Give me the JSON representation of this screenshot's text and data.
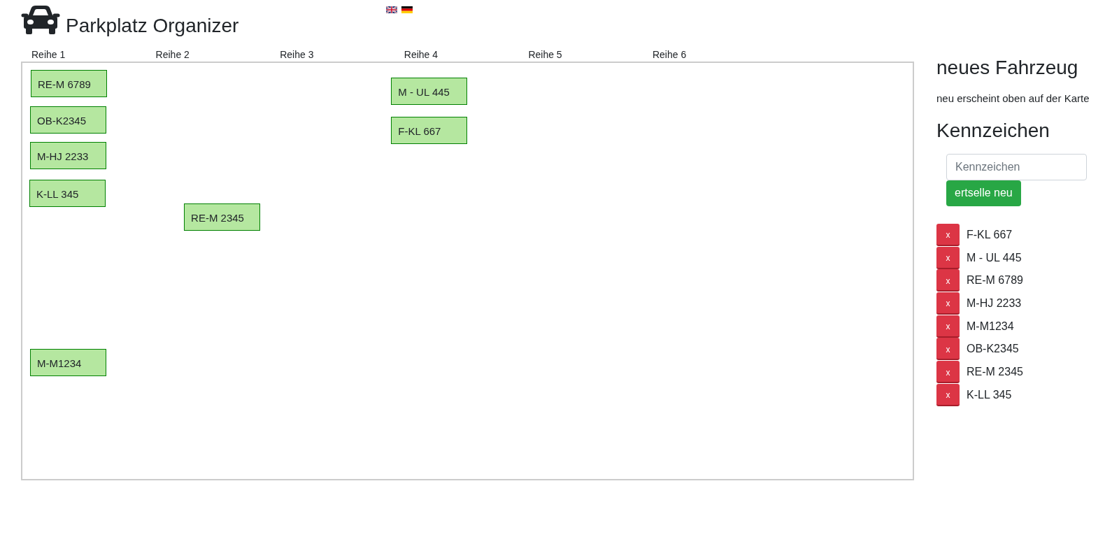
{
  "header": {
    "title": "Parkplatz Organizer"
  },
  "map": {
    "lanes": [
      {
        "label": "Reihe 1",
        "cars": [
          {
            "plate": "RE-M 6789"
          },
          {
            "plate": "OB-K2345"
          },
          {
            "plate": "M-HJ 2233"
          },
          {
            "plate": "K-LL 345"
          },
          {
            "plate": "M-M1234"
          }
        ]
      },
      {
        "label": "Reihe 2",
        "cars": [
          {
            "plate": "RE-M 2345"
          }
        ]
      },
      {
        "label": "Reihe 3"
      },
      {
        "label": "Reihe 4",
        "cars": [
          {
            "plate": "M - UL 445"
          },
          {
            "plate": "F-KL 667"
          }
        ]
      },
      {
        "label": "Reihe 5"
      },
      {
        "label": "Reihe 6"
      }
    ]
  },
  "new_vehicle": {
    "title": "neues Fahrzeug",
    "hint": "neu erscheint oben auf der Karte",
    "plate_heading": "Kennzeichen",
    "plate_field": {
      "placeholder": "Kennzeichen"
    },
    "create_button": "ertselle neu"
  },
  "vehicle_list": [
    {
      "remove_button": "x",
      "plate": "F-KL 667"
    },
    {
      "remove_button": "x",
      "plate": "M - UL 445"
    },
    {
      "remove_button": "x",
      "plate": "RE-M 6789"
    },
    {
      "remove_button": "x",
      "plate": "M-HJ 2233"
    },
    {
      "remove_button": "x",
      "plate": "M-M1234"
    },
    {
      "remove_button": "x",
      "plate": "OB-K2345"
    },
    {
      "remove_button": "x",
      "plate": "RE-M 2345"
    },
    {
      "remove_button": "x",
      "plate": "K-LL 345"
    }
  ]
}
